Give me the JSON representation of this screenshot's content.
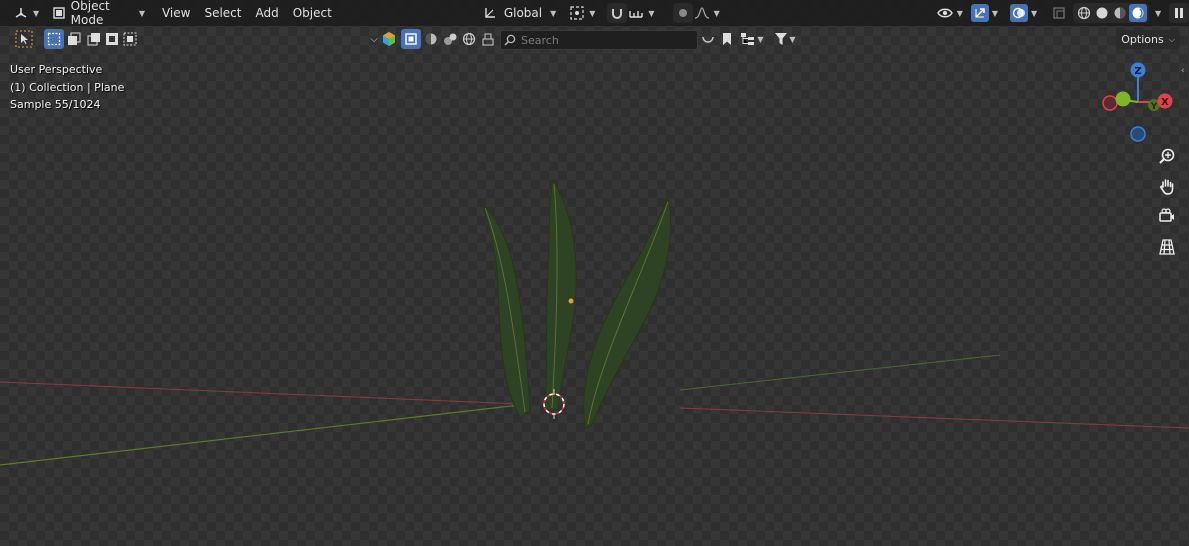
{
  "header": {
    "editor_type_icon": "3d-viewport-icon",
    "mode_label": "Object Mode",
    "menus": [
      "View",
      "Select",
      "Add",
      "Object"
    ],
    "transform_orientation": "Global"
  },
  "toolbar": {
    "search_placeholder": "Search",
    "options_label": "Options"
  },
  "viewport": {
    "view_name": "User Perspective",
    "collection_info": "(1) Collection | Plane",
    "sample_info": "Sample 55/1024"
  },
  "gizmo": {
    "z_label": "Z",
    "x_label": "X",
    "y_label": "Y",
    "colors": {
      "x": "#e0424f",
      "y": "#7fb628",
      "z": "#3d7ed6"
    }
  },
  "colors": {
    "accent": "#4772b3",
    "header_bg": "#1e1e1e",
    "fern": "#2e4224",
    "x_axis": "#8a3a44",
    "y_axis": "#5a7a2a"
  }
}
